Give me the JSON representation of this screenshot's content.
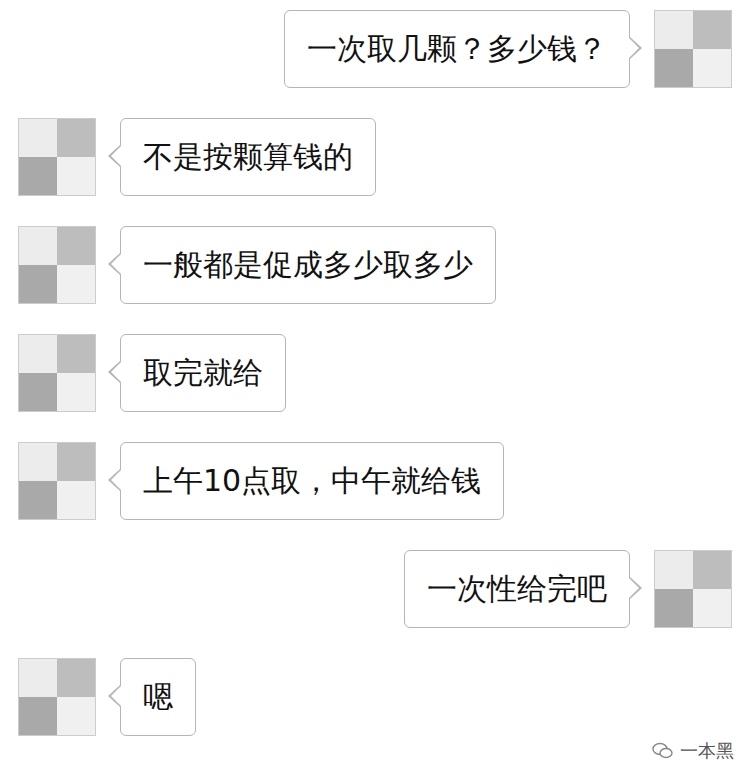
{
  "messages": [
    {
      "kind": "sent",
      "text": "一次取几颗？多少钱？"
    },
    {
      "kind": "received",
      "text": "不是按颗算钱的"
    },
    {
      "kind": "received",
      "text": "一般都是促成多少取多少"
    },
    {
      "kind": "received",
      "text": "取完就给"
    },
    {
      "kind": "received",
      "text": "上午10点取，中午就给钱"
    },
    {
      "kind": "sent",
      "text": "一次性给完吧"
    },
    {
      "kind": "received",
      "text": "嗯"
    }
  ],
  "watermark": {
    "text": "一本黑"
  }
}
